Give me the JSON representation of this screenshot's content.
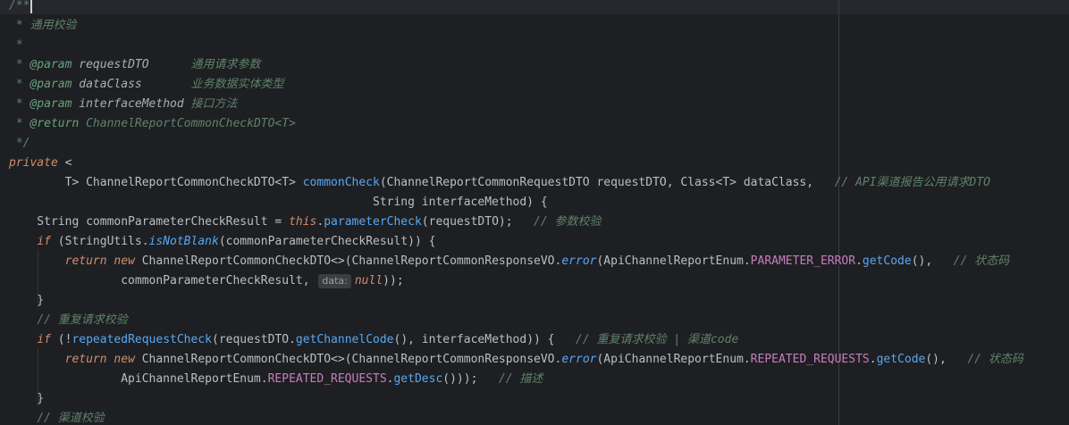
{
  "theme": {
    "background": "#1e1f22",
    "comment": "#5f826b",
    "keyword": "#cf8e6d",
    "method": "#56a8f5",
    "constant": "#c77dbb",
    "text": "#bcbec4"
  },
  "lines": [
    [
      {
        "t": "/**",
        "c": "cmt"
      }
    ],
    [
      {
        "t": " * ",
        "c": "cmt"
      },
      {
        "t": "通用校验",
        "c": "cmt"
      }
    ],
    [
      {
        "t": " *",
        "c": "cmt"
      }
    ],
    [
      {
        "t": " * ",
        "c": "cmt"
      },
      {
        "t": "@param",
        "c": "tag"
      },
      {
        "t": " requestDTO",
        "c": "par"
      },
      {
        "t": "      通用请求参数",
        "c": "cmt"
      }
    ],
    [
      {
        "t": " * ",
        "c": "cmt"
      },
      {
        "t": "@param",
        "c": "tag"
      },
      {
        "t": " dataClass",
        "c": "par"
      },
      {
        "t": "       业务数据实体类型",
        "c": "cmt"
      }
    ],
    [
      {
        "t": " * ",
        "c": "cmt"
      },
      {
        "t": "@param",
        "c": "tag"
      },
      {
        "t": " interfaceMethod",
        "c": "par"
      },
      {
        "t": " 接口方法",
        "c": "cmt"
      }
    ],
    [
      {
        "t": " * ",
        "c": "cmt"
      },
      {
        "t": "@return",
        "c": "tag"
      },
      {
        "t": " ChannelReportCommonCheckDTO<T>",
        "c": "cmt"
      }
    ],
    [
      {
        "t": " */",
        "c": "cmt"
      }
    ],
    [
      {
        "t": "private",
        "c": "kwi"
      },
      {
        "t": " <",
        "c": "typ"
      }
    ],
    [
      {
        "t": "        T> ",
        "c": "typ"
      },
      {
        "t": "ChannelReportCommonCheckDTO",
        "c": "typ"
      },
      {
        "t": "<T> ",
        "c": "typ"
      },
      {
        "t": "commonCheck",
        "c": "fnd"
      },
      {
        "t": "(ChannelReportCommonRequestDTO requestDTO, Class<T> dataClass,   ",
        "c": "typ"
      },
      {
        "t": "// API渠道报告公用请求DTO",
        "c": "cmt"
      }
    ],
    [
      {
        "t": "                                                    String interfaceMethod) {",
        "c": "typ"
      }
    ],
    [
      {
        "t": "    String commonParameterCheckResult = ",
        "c": "typ"
      },
      {
        "t": "this",
        "c": "this"
      },
      {
        "t": ".",
        "c": "typ"
      },
      {
        "t": "parameterCheck",
        "c": "fn"
      },
      {
        "t": "(requestDTO);   ",
        "c": "typ"
      },
      {
        "t": "// 参数校验",
        "c": "cmt"
      }
    ],
    [
      {
        "t": "    ",
        "c": "typ"
      },
      {
        "t": "if",
        "c": "kwi"
      },
      {
        "t": " (StringUtils.",
        "c": "typ"
      },
      {
        "t": "isNotBlank",
        "c": "sfn"
      },
      {
        "t": "(commonParameterCheckResult)) {",
        "c": "typ"
      }
    ],
    [
      {
        "t": "        ",
        "c": "typ"
      },
      {
        "t": "return",
        "c": "kwi"
      },
      {
        "t": " ",
        "c": "typ"
      },
      {
        "t": "new",
        "c": "kwi"
      },
      {
        "t": " ChannelReportCommonCheckDTO<>(ChannelReportCommonResponseVO.",
        "c": "typ"
      },
      {
        "t": "error",
        "c": "sfn"
      },
      {
        "t": "(ApiChannelReportEnum.",
        "c": "typ"
      },
      {
        "t": "PARAMETER_ERROR",
        "c": "cst"
      },
      {
        "t": ".",
        "c": "typ"
      },
      {
        "t": "getCode",
        "c": "fn"
      },
      {
        "t": "(),   ",
        "c": "typ"
      },
      {
        "t": "// 状态码",
        "c": "cmt"
      }
    ],
    [
      {
        "t": "                commonParameterCheckResult, ",
        "c": "typ"
      },
      {
        "hint": "data:"
      },
      {
        "t": "null",
        "c": "kwi"
      },
      {
        "t": "));",
        "c": "typ"
      }
    ],
    [
      {
        "t": "    }",
        "c": "typ"
      }
    ],
    [
      {
        "t": "    ",
        "c": "typ"
      },
      {
        "t": "// 重复请求校验",
        "c": "cmt"
      }
    ],
    [
      {
        "t": "    ",
        "c": "typ"
      },
      {
        "t": "if",
        "c": "kwi"
      },
      {
        "t": " (!",
        "c": "typ"
      },
      {
        "t": "repeatedRequestCheck",
        "c": "fn"
      },
      {
        "t": "(requestDTO.",
        "c": "typ"
      },
      {
        "t": "getChannelCode",
        "c": "fn"
      },
      {
        "t": "(), interfaceMethod)) {   ",
        "c": "typ"
      },
      {
        "t": "// 重复请求校验 | 渠道code",
        "c": "cmt"
      }
    ],
    [
      {
        "t": "        ",
        "c": "typ"
      },
      {
        "t": "return",
        "c": "kwi"
      },
      {
        "t": " ",
        "c": "typ"
      },
      {
        "t": "new",
        "c": "kwi"
      },
      {
        "t": " ChannelReportCommonCheckDTO<>(ChannelReportCommonResponseVO.",
        "c": "typ"
      },
      {
        "t": "error",
        "c": "sfn"
      },
      {
        "t": "(ApiChannelReportEnum.",
        "c": "typ"
      },
      {
        "t": "REPEATED_REQUESTS",
        "c": "cst"
      },
      {
        "t": ".",
        "c": "typ"
      },
      {
        "t": "getCode",
        "c": "fn"
      },
      {
        "t": "(),   ",
        "c": "typ"
      },
      {
        "t": "// 状态码",
        "c": "cmt"
      }
    ],
    [
      {
        "t": "                ApiChannelReportEnum.",
        "c": "typ"
      },
      {
        "t": "REPEATED_REQUESTS",
        "c": "cst"
      },
      {
        "t": ".",
        "c": "typ"
      },
      {
        "t": "getDesc",
        "c": "fn"
      },
      {
        "t": "()));   ",
        "c": "typ"
      },
      {
        "t": "// 描述",
        "c": "cmt"
      }
    ],
    [
      {
        "t": "    }",
        "c": "typ"
      }
    ],
    [
      {
        "t": "    ",
        "c": "typ"
      },
      {
        "t": "// 渠道校验",
        "c": "cmt"
      }
    ]
  ]
}
